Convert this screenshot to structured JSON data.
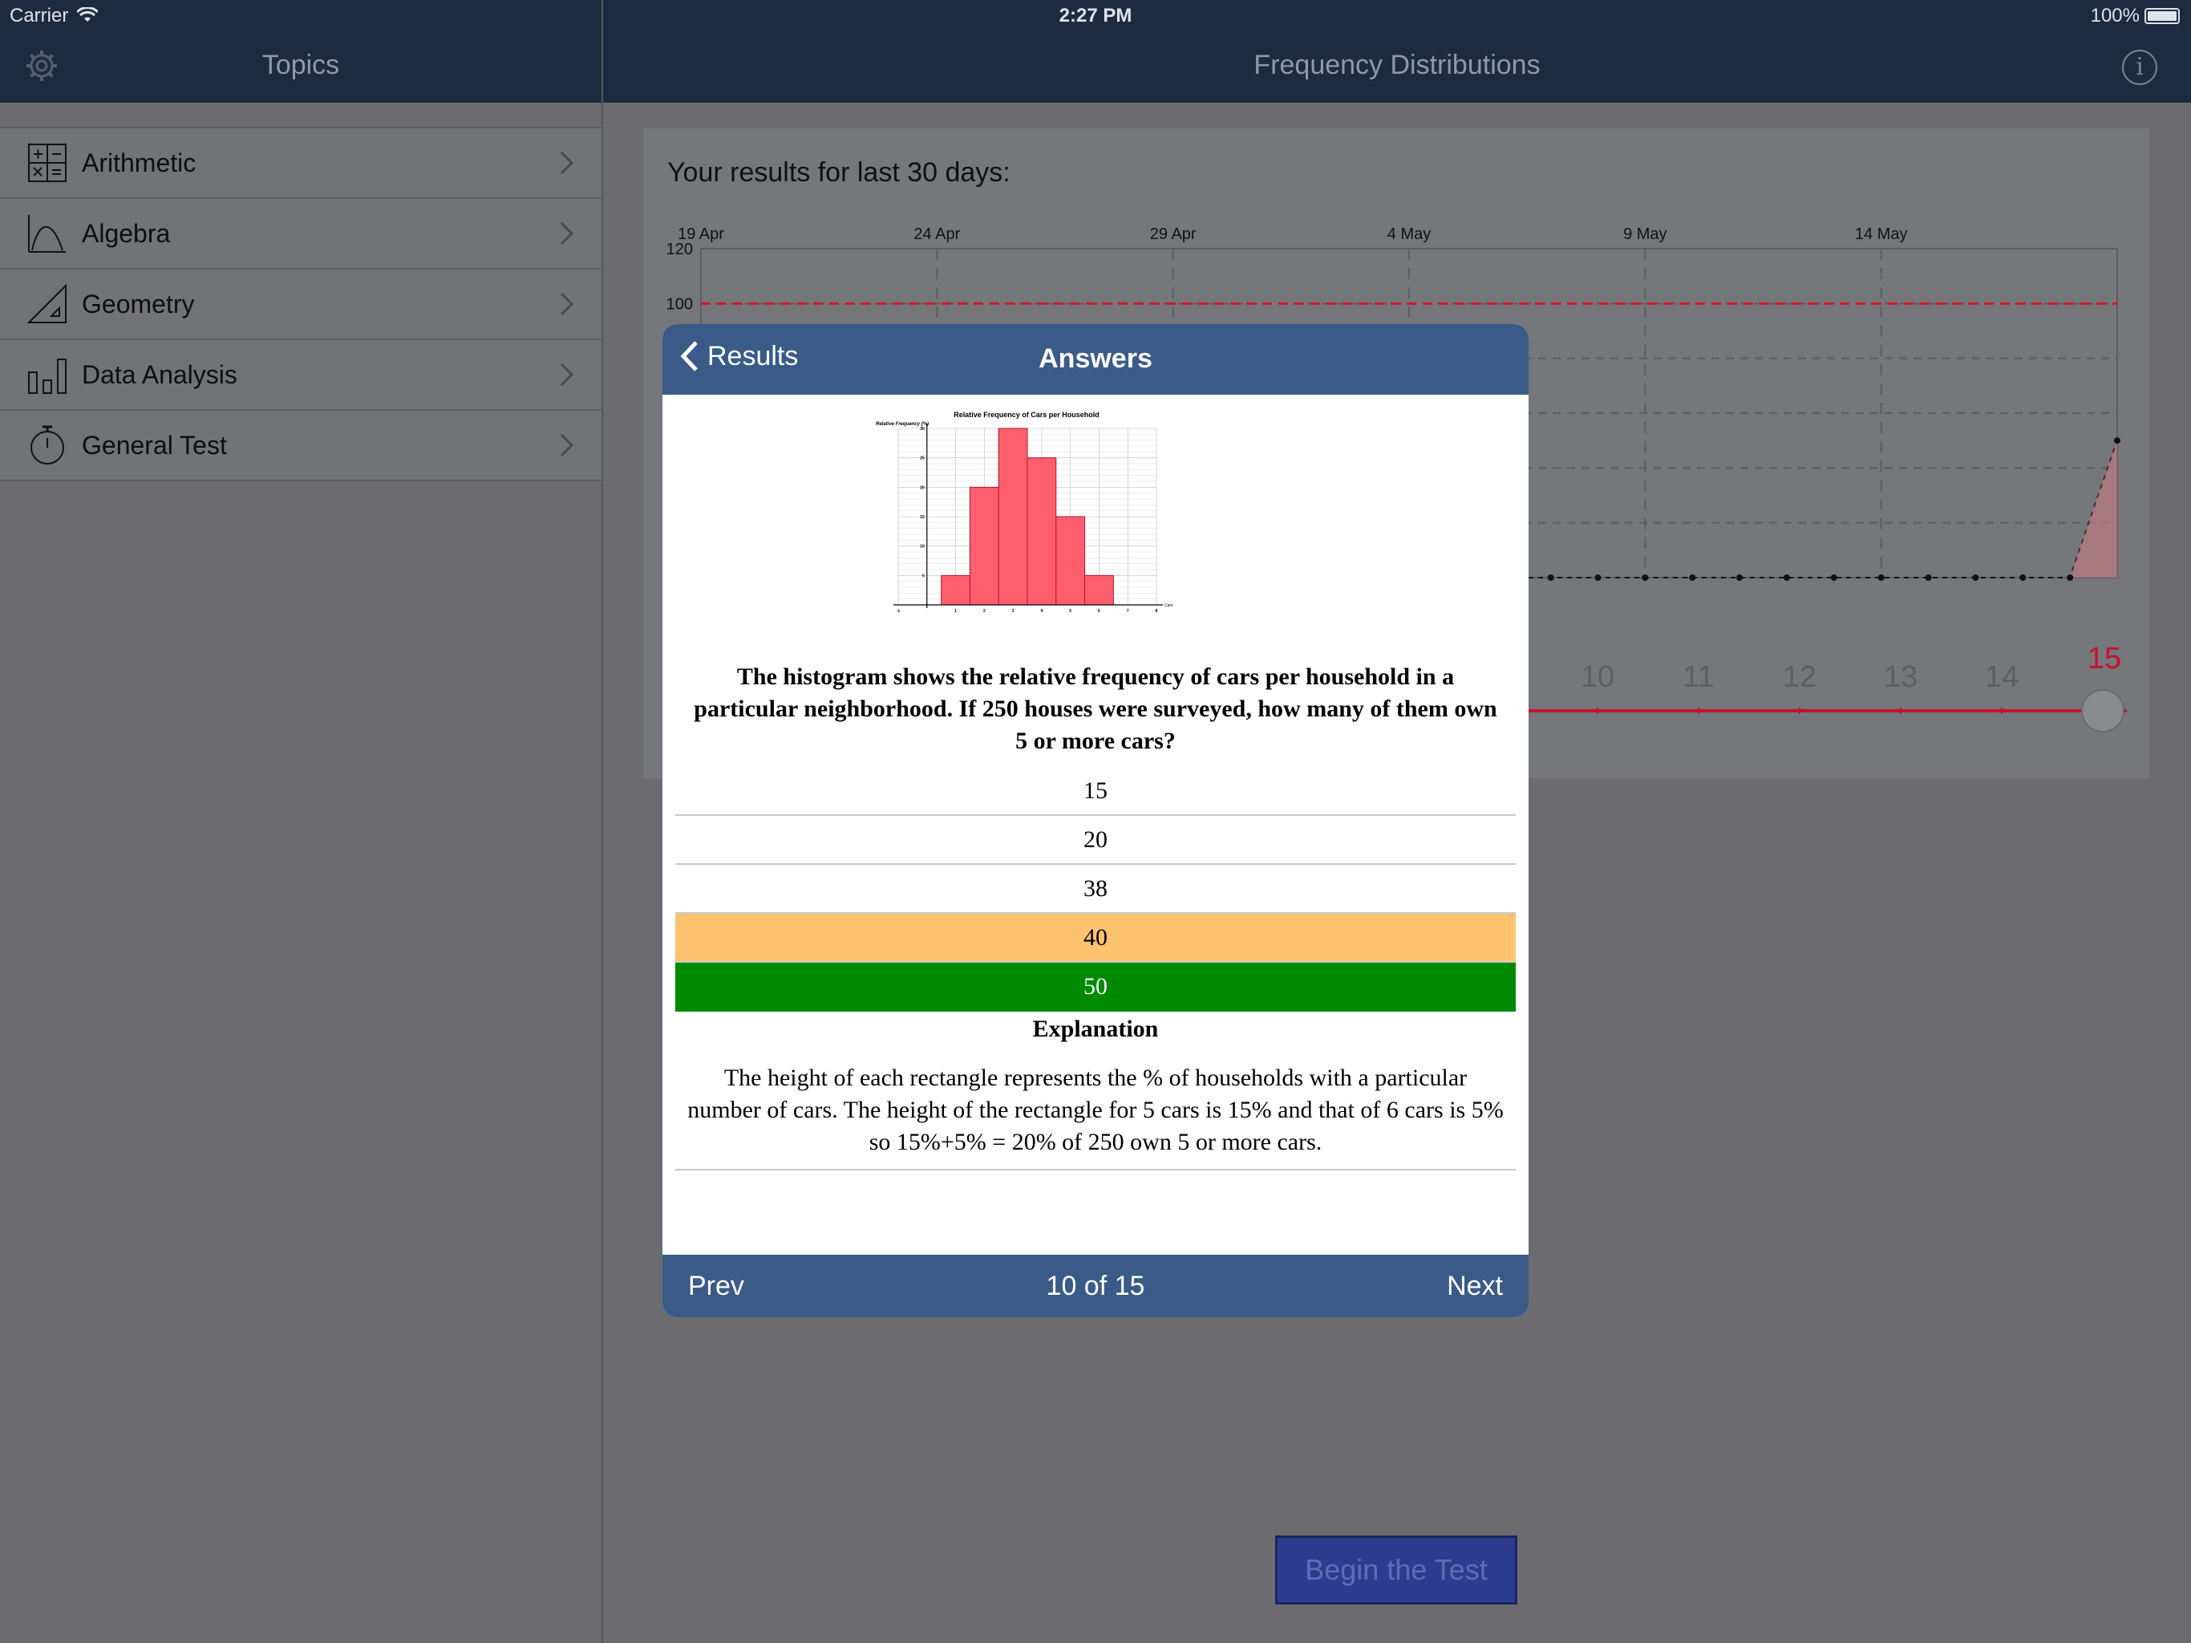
{
  "status_bar": {
    "carrier": "Carrier",
    "time": "2:27 PM",
    "battery": "100%"
  },
  "sidebar": {
    "title": "Topics",
    "items": [
      {
        "label": "Arithmetic",
        "icon": "calculator-icon"
      },
      {
        "label": "Algebra",
        "icon": "parabola-icon"
      },
      {
        "label": "Geometry",
        "icon": "set-square-icon"
      },
      {
        "label": "Data Analysis",
        "icon": "bar-chart-icon"
      },
      {
        "label": "General Test",
        "icon": "stopwatch-icon"
      }
    ]
  },
  "main": {
    "title": "Frequency Distributions",
    "results_title": "Your results for last 30 days:",
    "begin_button": "Begin the Test"
  },
  "chart_data": [
    {
      "type": "line",
      "x_tick_labels": [
        "19 Apr",
        "24 Apr",
        "29 Apr",
        "4 May",
        "9 May",
        "14 May"
      ],
      "y_tick_labels": [
        "120",
        "100"
      ],
      "target_line_y": 100,
      "series": [
        {
          "values": [
            0,
            0,
            0,
            0,
            0,
            0,
            0,
            0,
            0,
            0,
            0,
            0,
            0,
            0,
            0,
            0,
            0,
            0,
            0,
            0,
            0,
            0,
            0,
            0,
            0,
            0,
            0,
            0,
            0,
            0,
            50
          ]
        }
      ],
      "grid": true
    },
    {
      "type": "bar",
      "title": "Relative Frequency of Cars per Household",
      "ylabel": "Relative Frequency (%)",
      "xlabel": "Cars",
      "categories": [
        1,
        2,
        3,
        4,
        5,
        6
      ],
      "values": [
        5,
        20,
        30,
        25,
        15,
        5
      ],
      "x_ticks": [
        "-1",
        "1",
        "2",
        "3",
        "4",
        "5",
        "6",
        "7",
        "8"
      ],
      "y_ticks": [
        "5",
        "10",
        "15",
        "20",
        "25",
        "30"
      ],
      "xlim": [
        -1,
        8
      ],
      "ylim": [
        0,
        30
      ],
      "grid": true
    }
  ],
  "slider": {
    "ticks": [
      "10",
      "11",
      "12",
      "13",
      "14"
    ],
    "value": "15",
    "accent": "#c8102e"
  },
  "modal": {
    "back_label": "Results",
    "title": "Answers",
    "question": "The histogram shows the relative frequency of cars per household in a particular neighborhood. If 250 houses were surveyed, how many of them own 5 or more cars?",
    "answers": [
      {
        "label": "15",
        "state": "none"
      },
      {
        "label": "20",
        "state": "none"
      },
      {
        "label": "38",
        "state": "none"
      },
      {
        "label": "40",
        "state": "wrong"
      },
      {
        "label": "50",
        "state": "correct"
      }
    ],
    "explanation_title": "Explanation",
    "explanation": "The height of each rectangle represents the % of households with a particular number of cars. The height of the rectangle for 5 cars is 15% and that of 6 cars is 5% so 15%+5% = 20% of 250 own 5 or more cars.",
    "prev": "Prev",
    "position": "10 of 15",
    "next": "Next"
  },
  "colors": {
    "nav_bg": "#1c2b3f",
    "modal_bar": "#3a5b88",
    "wrong": "#ffc26e",
    "correct": "#008a00",
    "bar_fill": "#ff5f6d"
  }
}
